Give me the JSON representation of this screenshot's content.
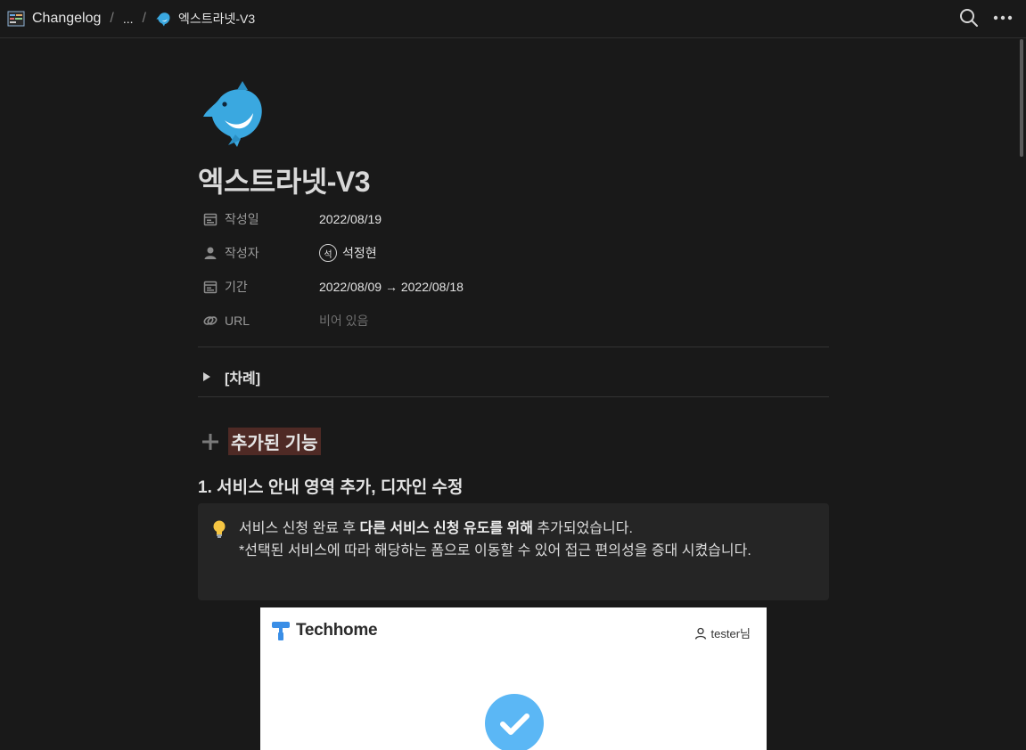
{
  "topbar": {
    "root": "Changelog",
    "ellipsis": "...",
    "current": "엑스트라넷-V3"
  },
  "page": {
    "title": "엑스트라넷-V3",
    "icon": "dolphin-icon"
  },
  "properties": [
    {
      "icon": "calendar-icon",
      "name": "작성일",
      "value": "2022/08/19"
    },
    {
      "icon": "person-icon",
      "name": "작성자",
      "value": "석정현",
      "avatar": "석"
    },
    {
      "icon": "calendar-icon",
      "name": "기간",
      "value": "2022/08/09 → 2022/08/18"
    },
    {
      "icon": "link-icon",
      "name": "URL",
      "value": "비어 있음"
    }
  ],
  "toggle": {
    "label": "[차례]"
  },
  "heading1": {
    "text": "추가된 기능"
  },
  "heading3": {
    "text": "1. 서비스 안내 영역 추가, 디자인 수정"
  },
  "callout": {
    "pre": "서비스 신청 완료 후 ",
    "bold": "다른 서비스 신청 유도를 위해",
    "post": " 추가되었습니다.",
    "line2": "*선택된 서비스에 따라 해당하는 폼으로 이동할 수 있어 접근 편의성을 증대 시켰습니다."
  },
  "screenshot": {
    "brand": "Techhome",
    "user": "tester님"
  },
  "colors": {
    "background": "#191919",
    "heading_highlight": "#4f2a25",
    "callout_bg": "#252525",
    "check_blue": "#5bb7f5"
  }
}
